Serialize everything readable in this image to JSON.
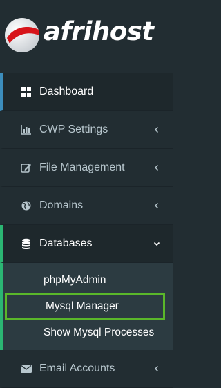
{
  "brand": {
    "name": "afrihost"
  },
  "nav": {
    "dashboard": {
      "label": "Dashboard",
      "icon": "dashboard-icon"
    },
    "cwp_settings": {
      "label": "CWP Settings",
      "icon": "bar-chart-icon"
    },
    "file_management": {
      "label": "File Management",
      "icon": "edit-icon"
    },
    "domains": {
      "label": "Domains",
      "icon": "globe-icon"
    },
    "databases": {
      "label": "Databases",
      "icon": "database-icon",
      "sub": {
        "phpmyadmin": "phpMyAdmin",
        "mysql_manager": "Mysql Manager",
        "show_processes": "Show Mysql Processes"
      }
    },
    "email_accounts": {
      "label": "Email Accounts",
      "icon": "envelope-icon"
    }
  },
  "colors": {
    "sidebar_bg": "#222d32",
    "active_bg": "#1e282c",
    "submenu_bg": "#2c3b41",
    "active_accent": "#2bb673",
    "highlight_box": "#5ab72a",
    "text_muted": "#b8c7ce",
    "logo_red": "#d7141a"
  }
}
